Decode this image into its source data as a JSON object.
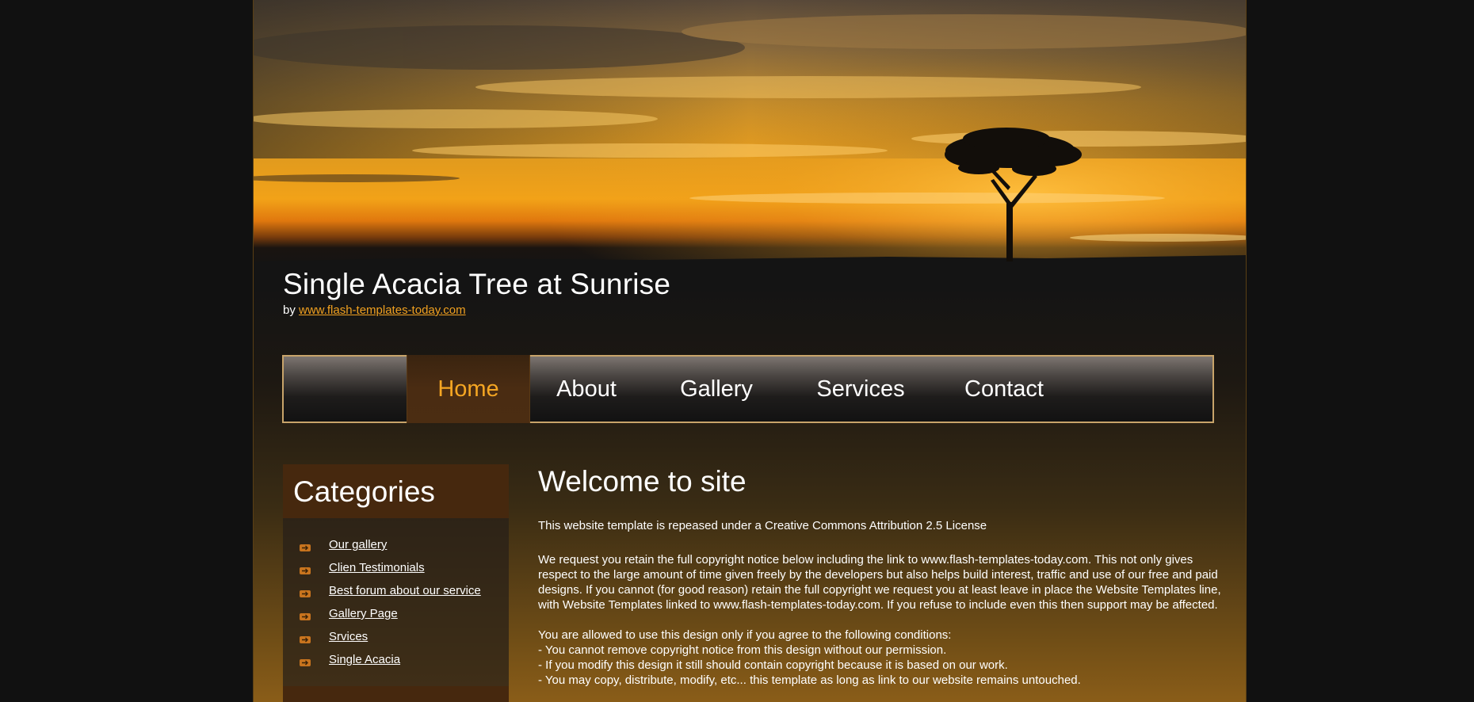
{
  "header": {
    "title": "Single Acacia Tree at Sunrise",
    "by_prefix": "by",
    "by_link": "www.flash-templates-today.com"
  },
  "nav": {
    "items": [
      {
        "label": "Home",
        "active": true
      },
      {
        "label": "About",
        "active": false
      },
      {
        "label": "Gallery",
        "active": false
      },
      {
        "label": "Services",
        "active": false
      },
      {
        "label": "Contact",
        "active": false
      }
    ]
  },
  "sidebar": {
    "title": "Categories",
    "items": [
      {
        "label": "Our gallery"
      },
      {
        "label": "Clien Testimonials"
      },
      {
        "label": "Best forum about our service"
      },
      {
        "label": "Gallery Page"
      },
      {
        "label": "Srvices"
      },
      {
        "label": "Single Acacia"
      }
    ]
  },
  "main": {
    "heading": "Welcome to site",
    "intro": "This website template is repeased under a Creative Commons Attribution 2.5 License",
    "paragraph": "We request you retain the full copyright notice below including the link to www.flash-templates-today.com. This not only gives respect to the large amount of time given freely by the developers but also helps build interest, traffic and use of our free and paid designs. If you cannot (for good reason) retain the full copyright we request you at least leave in place the Website Templates line, with Website Templates linked to www.flash-templates-today.com. If you refuse to include even this then support may be affected.",
    "conditions": [
      "You are allowed to use this design only if you agree to the following conditions:",
      "- You cannot remove copyright notice from this design without our permission.",
      "- If you modify this design it still should contain copyright because it is based on our work.",
      "- You may copy, distribute, modify, etc... this template as long as link to our website remains untouched."
    ]
  },
  "colors": {
    "accent": "#f5a623",
    "nav_border": "#c8a46a",
    "sidebar_header": "#46280e",
    "background": "#111111"
  }
}
